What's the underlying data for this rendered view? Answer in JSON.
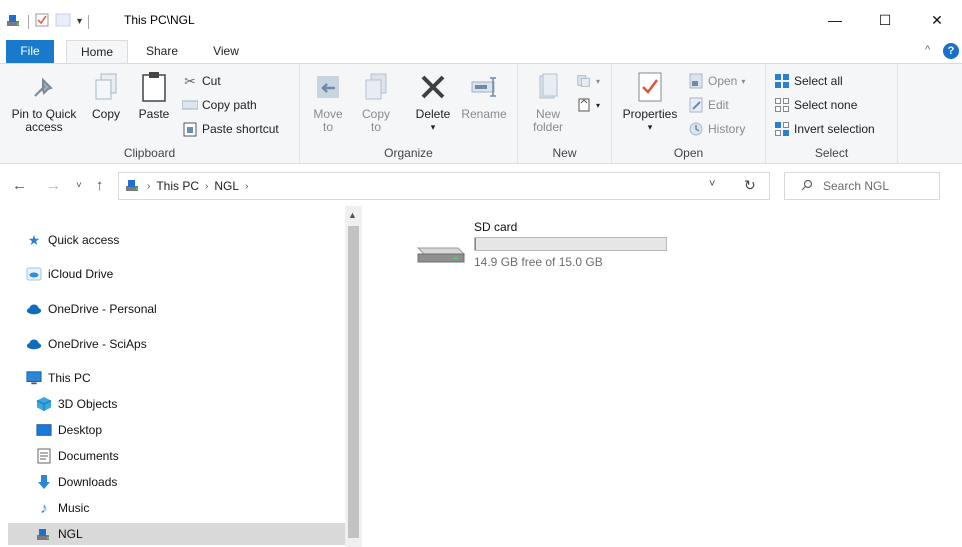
{
  "titlebar": {
    "path": "This PC\\NGL",
    "minimize": "—",
    "maximize": "☐",
    "close": "✕"
  },
  "ribbon_tabs": [
    "File",
    "Home",
    "Share",
    "View"
  ],
  "clipboard": {
    "group_label": "Clipboard",
    "pin": "Pin to Quick access",
    "copy": "Copy",
    "paste": "Paste",
    "cut": "Cut",
    "copy_path": "Copy path",
    "paste_shortcut": "Paste shortcut"
  },
  "organize": {
    "group_label": "Organize",
    "move_to": "Move to",
    "copy_to": "Copy to",
    "delete": "Delete",
    "rename": "Rename"
  },
  "new": {
    "group_label": "New",
    "new_folder": "New folder"
  },
  "open": {
    "group_label": "Open",
    "properties": "Properties",
    "open": "Open",
    "edit": "Edit",
    "history": "History"
  },
  "select": {
    "group_label": "Select",
    "select_all": "Select all",
    "select_none": "Select none",
    "invert": "Invert selection"
  },
  "address": {
    "crumbs": [
      "This PC",
      "NGL"
    ],
    "sep": "›"
  },
  "search": {
    "placeholder": "Search NGL"
  },
  "nav": {
    "items": [
      {
        "label": "Quick access"
      },
      {
        "label": "iCloud Drive"
      },
      {
        "label": "OneDrive - Personal"
      },
      {
        "label": "OneDrive - SciAps"
      },
      {
        "label": "This PC"
      },
      {
        "label": "3D Objects"
      },
      {
        "label": "Desktop"
      },
      {
        "label": "Documents"
      },
      {
        "label": "Downloads"
      },
      {
        "label": "Music"
      },
      {
        "label": "NGL"
      }
    ]
  },
  "drive": {
    "name": "SD card",
    "free_text": "14.9 GB free of 15.0 GB",
    "used_fraction": 0.007
  },
  "colors": {
    "accent": "#1979ca",
    "selection": "#d9d9d9"
  }
}
